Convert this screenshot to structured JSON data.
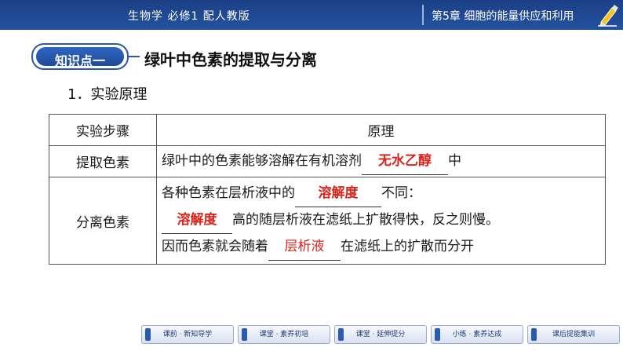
{
  "header": {
    "book": "生物学  必修1  配人教版",
    "chapter": "第5章   细胞的能量供应和利用",
    "icon": "pencil-icon"
  },
  "knowledge_point": {
    "badge": "知识点一",
    "title": "绿叶中色素的提取与分离"
  },
  "section": {
    "title": "1．实验原理"
  },
  "table": {
    "headers": [
      "实验步骤",
      "原理"
    ],
    "rows": [
      {
        "step": "提取色素",
        "text_before": "绿叶中的色素能够溶解在有机溶剂",
        "answer": "无水乙醇",
        "text_after": "中"
      },
      {
        "step": "分离色素",
        "line1_before": "各种色素在层析液中的",
        "line1_answer": "溶解度",
        "line1_after": "不同：",
        "line2_answer": "溶解度",
        "line2_after": "高的随层析液在滤纸上扩散得快，反之则慢。",
        "line3_before": "因而色素就会随着",
        "line3_answer": "层析液",
        "line3_after": "在滤纸上的扩散而分开"
      }
    ]
  },
  "nav": [
    "课前 · 新知导学",
    "课堂 · 素养初培",
    "课堂 · 延伸提分",
    "小练 · 素养达成",
    "课后提能集训"
  ],
  "colors": {
    "header_bg": "#23529f",
    "answer": "#d9241c",
    "badge": "#2a59a8"
  }
}
